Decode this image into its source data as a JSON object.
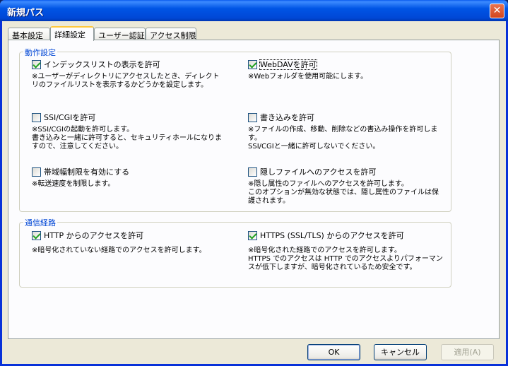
{
  "window": {
    "title": "新規パス",
    "close_glyph": "✕"
  },
  "tabs": [
    {
      "label": "基本設定",
      "active": false
    },
    {
      "label": "詳細設定",
      "active": true
    },
    {
      "label": "ユーザー認証",
      "active": false
    },
    {
      "label": "アクセス制限",
      "active": false
    }
  ],
  "groups": {
    "behavior": {
      "title": "動作設定",
      "options": [
        {
          "label": "インデックスリストの表示を許可",
          "checked": true,
          "desc": "※ユーザーがディレクトリにアクセスしたとき、ディレクトリのファイルリストを表示するかどうかを設定します。"
        },
        {
          "label": "WebDAVを許可",
          "checked": true,
          "desc": "※Webフォルダを使用可能にします。"
        },
        {
          "label": "SSI/CGIを許可",
          "checked": false,
          "desc": "※SSI/CGIの起動を許可します。\n書き込みと一緒に許可すると、セキュリティホールになりますので、注意してください。"
        },
        {
          "label": "書き込みを許可",
          "checked": false,
          "desc": "※ファイルの作成、移動、削除などの書込み操作を許可します。\nSSI/CGIと一緒に許可しないでください。"
        },
        {
          "label": "帯域幅制限を有効にする",
          "checked": false,
          "desc": "※転送速度を制限します。"
        },
        {
          "label": "隠しファイルへのアクセスを許可",
          "checked": false,
          "desc": "※隠し属性のファイルへのアクセスを許可します。\nこのオプションが無効な状態では、隠し属性のファイルは保護されます。"
        }
      ]
    },
    "channel": {
      "title": "通信経路",
      "options": [
        {
          "label": "HTTP からのアクセスを許可",
          "checked": true,
          "desc": "※暗号化されていない経路でのアクセスを許可します。"
        },
        {
          "label": "HTTPS (SSL/TLS) からのアクセスを許可",
          "checked": true,
          "desc": "※暗号化された経路でのアクセスを許可します。\nHTTPS でのアクセスは HTTP でのアクセスよりパフォーマンスが低下しますが、暗号化されているため安全です。"
        }
      ]
    }
  },
  "buttons": {
    "ok": "OK",
    "cancel": "キャンセル",
    "apply": "適用(A)"
  }
}
